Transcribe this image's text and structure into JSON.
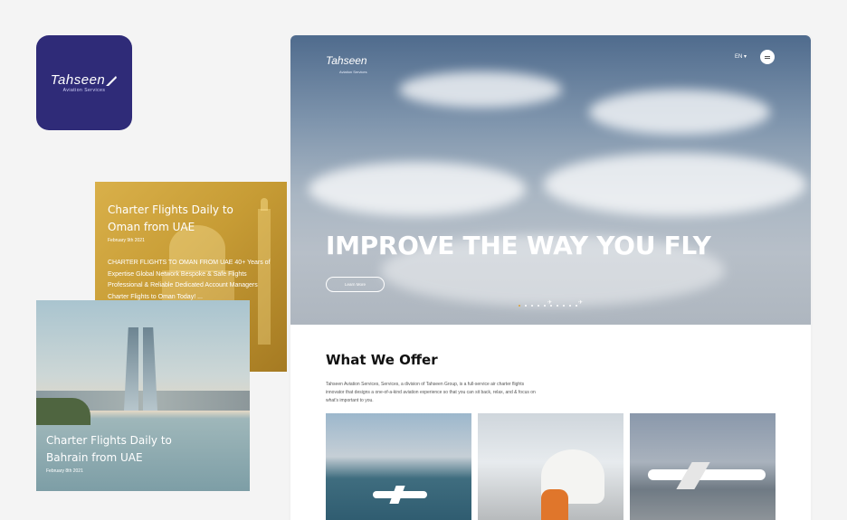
{
  "logo_tile": {
    "brand": "Tahseen",
    "subtitle": "Aviation Services"
  },
  "oman_card": {
    "title": "Charter Flights Daily to Oman from UAE",
    "date": "February 9th 2021",
    "body": "CHARTER FLIGHTS TO OMAN FROM UAE 40+ Years of Expertise Global Network Bespoke & Safe Flights Professional & Reliable Dedicated Account Managers Charter Flights to Oman Today! ..."
  },
  "bahrain_card": {
    "title": "Charter Flights Daily to Bahrain from UAE",
    "date": "February 8th 2021"
  },
  "site": {
    "logo": "Tahseen",
    "logo_sub": "Aviation Services",
    "language": "EN",
    "headline": "IMPROVE THE WAY YOU FLY",
    "learn_more": "Learn More",
    "slider": {
      "total": 10,
      "active": 0
    },
    "offer_heading": "What We Offer",
    "offer_desc": "Tahseen Aviation Services, Services, a division of Tahseen Group, is a full-service air charter flights innovator that designs a one-of-a-kind aviation experience so that you can sit back, relax, and & focus on what's important to you."
  },
  "colors": {
    "brand": "#2f2b78",
    "accent": "#e0a133"
  }
}
